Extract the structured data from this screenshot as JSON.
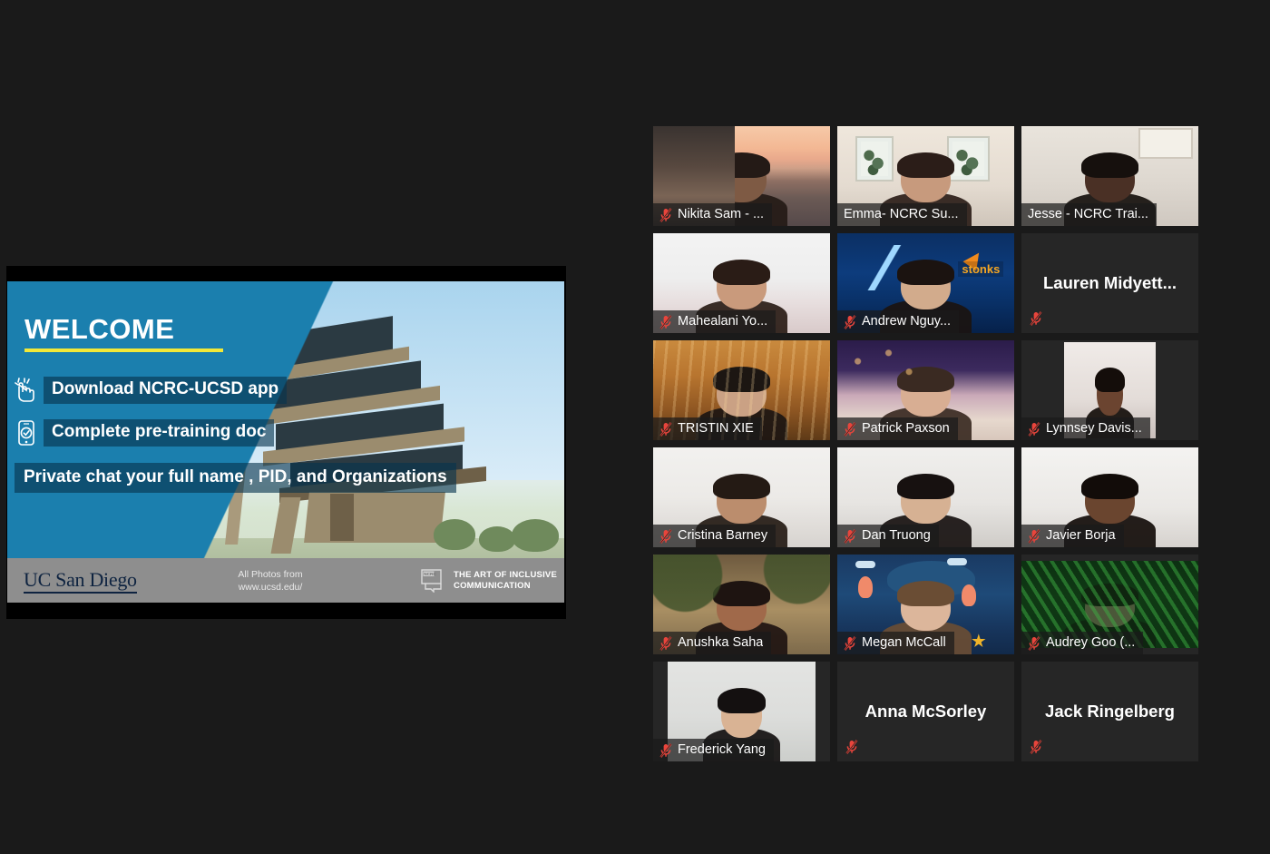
{
  "meta": {
    "app": "zoom-meeting",
    "background_color": "#1a1a1a",
    "active_speaker_color": "#e9f23c",
    "mic_muted_color": "#e8453c"
  },
  "shared_slide": {
    "title": "WELCOME",
    "bullets": [
      {
        "icon": "tap-hand-icon",
        "text": "Download NCRC-UCSD app"
      },
      {
        "icon": "mobile-check-icon",
        "text": "Complete pre-training doc"
      }
    ],
    "callout": "Private chat  your full name , PID, and Organizations",
    "footer": {
      "university_logo": "UC San Diego",
      "photo_credit_line1": "All Photos from",
      "photo_credit_line2": "www.ucsd.edu/",
      "ncrc_mark": "NCRC",
      "tagline_line1": "THE ART OF INCLUSIVE",
      "tagline_line2": "COMMUNICATION"
    },
    "colors": {
      "teal": "#1b7fae",
      "accent_rule": "#f2e838",
      "band": "#07344e",
      "footer_bar": "#8e8e8e"
    }
  },
  "participants": [
    {
      "name": "Nikita Sam - ...",
      "muted": true,
      "video": true,
      "active_speaker": false,
      "style": "v-nikita",
      "fit": "fill"
    },
    {
      "name": "Emma- NCRC Su...",
      "muted": false,
      "video": true,
      "active_speaker": true,
      "style": "v-emma",
      "fit": "fill"
    },
    {
      "name": "Jesse - NCRC Trai...",
      "muted": false,
      "video": true,
      "active_speaker": false,
      "style": "v-jesse",
      "fit": "fill"
    },
    {
      "name": "Mahealani Yo...",
      "muted": true,
      "video": true,
      "active_speaker": false,
      "style": "v-mahealani",
      "fit": "fill"
    },
    {
      "name": "Andrew Nguy...",
      "muted": true,
      "video": true,
      "active_speaker": false,
      "style": "v-andrew",
      "fit": "fill"
    },
    {
      "name": "Lauren  Midyett...",
      "muted": true,
      "video": false,
      "active_speaker": false,
      "style": "",
      "fit": "none"
    },
    {
      "name": "TRISTIN XIE",
      "muted": true,
      "video": true,
      "active_speaker": false,
      "style": "v-tristin",
      "fit": "fill"
    },
    {
      "name": "Patrick Paxson",
      "muted": true,
      "video": true,
      "active_speaker": false,
      "style": "v-patrick",
      "fit": "fill"
    },
    {
      "name": "Lynnsey Davis...",
      "muted": true,
      "video": true,
      "active_speaker": false,
      "style": "v-lynnsey",
      "fit": "inset"
    },
    {
      "name": "Cristina Barney",
      "muted": true,
      "video": true,
      "active_speaker": false,
      "style": "v-cristina",
      "fit": "fill"
    },
    {
      "name": "Dan Truong",
      "muted": true,
      "video": true,
      "active_speaker": false,
      "style": "v-dan",
      "fit": "fill"
    },
    {
      "name": "Javier Borja",
      "muted": true,
      "video": true,
      "active_speaker": false,
      "style": "v-javier",
      "fit": "fill"
    },
    {
      "name": "Anushka Saha",
      "muted": true,
      "video": true,
      "active_speaker": false,
      "style": "v-anushka",
      "fit": "fill"
    },
    {
      "name": "Megan McCall",
      "muted": true,
      "video": true,
      "active_speaker": false,
      "style": "v-megan",
      "fit": "fill"
    },
    {
      "name": "Audrey Goo (...",
      "muted": true,
      "video": true,
      "active_speaker": false,
      "style": "v-audrey",
      "fit": "letterbox"
    },
    {
      "name": "Frederick Yang",
      "muted": true,
      "video": true,
      "active_speaker": false,
      "style": "v-frederick",
      "fit": "inset-w"
    },
    {
      "name": "Anna McSorley",
      "muted": true,
      "video": false,
      "active_speaker": false,
      "style": "",
      "fit": "none"
    },
    {
      "name": "Jack Ringelberg",
      "muted": true,
      "video": false,
      "active_speaker": false,
      "style": "",
      "fit": "none"
    }
  ]
}
